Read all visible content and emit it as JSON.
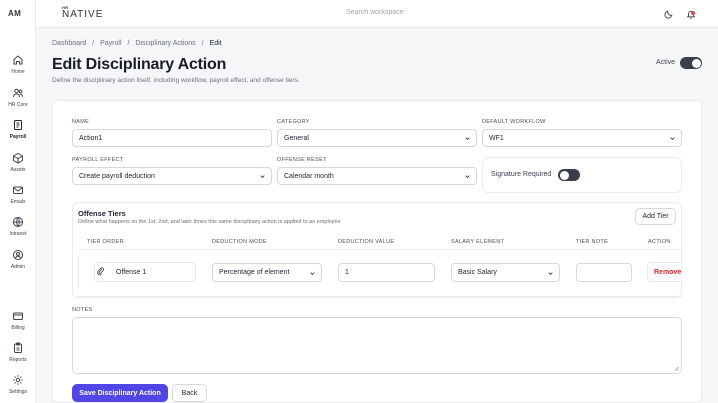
{
  "app": {
    "initials": "AM",
    "brand_small": "HR",
    "brand_name": "NATIVE",
    "search_placeholder": "Search workspace"
  },
  "sidebar": {
    "items": [
      {
        "label": "Home",
        "icon": "home-icon"
      },
      {
        "label": "HR Core",
        "icon": "users-icon"
      },
      {
        "label": "Payroll",
        "icon": "payroll-icon",
        "active": true
      },
      {
        "label": "Assets",
        "icon": "box-icon"
      },
      {
        "label": "Emails",
        "icon": "mail-icon"
      },
      {
        "label": "Intranet",
        "icon": "globe-icon"
      },
      {
        "label": "Admin",
        "icon": "admin-icon"
      },
      {
        "label": "Billing",
        "icon": "card-icon"
      },
      {
        "label": "Reports",
        "icon": "clipboard-icon"
      },
      {
        "label": "Settings",
        "icon": "gear-icon"
      }
    ]
  },
  "breadcrumb": {
    "items": [
      "Dashboard",
      "Payroll",
      "Disciplinary Actions",
      "Edit"
    ],
    "separator": "/"
  },
  "header": {
    "title": "Edit Disciplinary Action",
    "subtitle": "Define the disciplinary action itself, including workflow, payroll effect, and offense tiers.",
    "active_label": "Active",
    "active": true
  },
  "form": {
    "name_label": "NAME",
    "name_value": "Action1",
    "category_label": "CATEGORY",
    "category_value": "General",
    "workflow_label": "DEFAULT WORKFLOW",
    "workflow_value": "WF1",
    "payroll_effect_label": "PAYROLL EFFECT",
    "payroll_effect_value": "Create payroll deduction",
    "offense_reset_label": "OFFENSE RESET",
    "offense_reset_value": "Calendar month",
    "signature_label": "Signature Required",
    "signature_required": false
  },
  "tiers": {
    "title": "Offense Tiers",
    "subtitle": "Define what happens on the 1st, 2nd, and later times this same disciplinary action is applied to an employee",
    "add_label": "Add Tier",
    "columns": [
      "TIER ORDER",
      "DEDUCTION MODE",
      "DEDUCTION VALUE",
      "SALARY ELEMENT",
      "TIER NOTE",
      "ACTION"
    ],
    "rows": [
      {
        "name": "Offense 1",
        "deduction_mode": "Percentage of element",
        "deduction_value": "1",
        "salary_element": "Basic Salary",
        "note": "",
        "action": "Remove"
      }
    ]
  },
  "notes": {
    "label": "NOTES",
    "value": ""
  },
  "buttons": {
    "save": "Save Disciplinary Action",
    "back": "Back"
  },
  "colors": {
    "primary": "#4f46e5",
    "danger": "#d62d3a",
    "toggle": "#3a3f4b",
    "notification": "#e5484d"
  }
}
